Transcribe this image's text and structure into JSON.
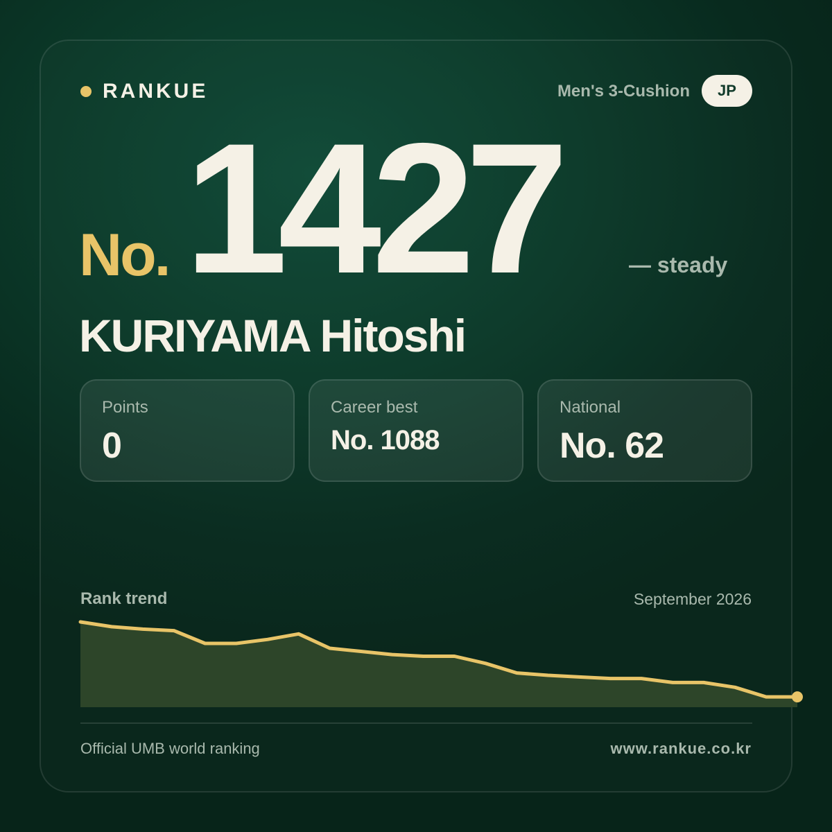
{
  "brand": {
    "name": "RANKUE"
  },
  "header": {
    "category": "Men's 3-Cushion",
    "country_code": "JP"
  },
  "rank": {
    "prefix": "No.",
    "value": "1427",
    "movement": "— steady"
  },
  "player": {
    "name": "KURIYAMA Hitoshi"
  },
  "stats": [
    {
      "label": "Points",
      "value": "0"
    },
    {
      "label": "Career best",
      "value": "No. 1088"
    },
    {
      "label": "National",
      "value": "No. 62"
    }
  ],
  "trend": {
    "title": "Rank trend",
    "period": "September 2026"
  },
  "chart_data": {
    "type": "area",
    "y_direction": "higher line = better rank",
    "values": [
      100,
      94,
      91,
      89,
      73,
      73,
      78,
      85,
      67,
      63,
      59,
      57,
      57,
      48,
      36,
      33,
      31,
      29,
      29,
      24,
      24,
      18,
      6,
      6
    ],
    "ylim": [
      0,
      100
    ],
    "line_color": "#e8c468",
    "fill_color": "#2d4529",
    "title": "",
    "xlabel": "",
    "ylabel": ""
  },
  "footer": {
    "source": "Official UMB world ranking",
    "website": "www.rankue.co.kr"
  }
}
